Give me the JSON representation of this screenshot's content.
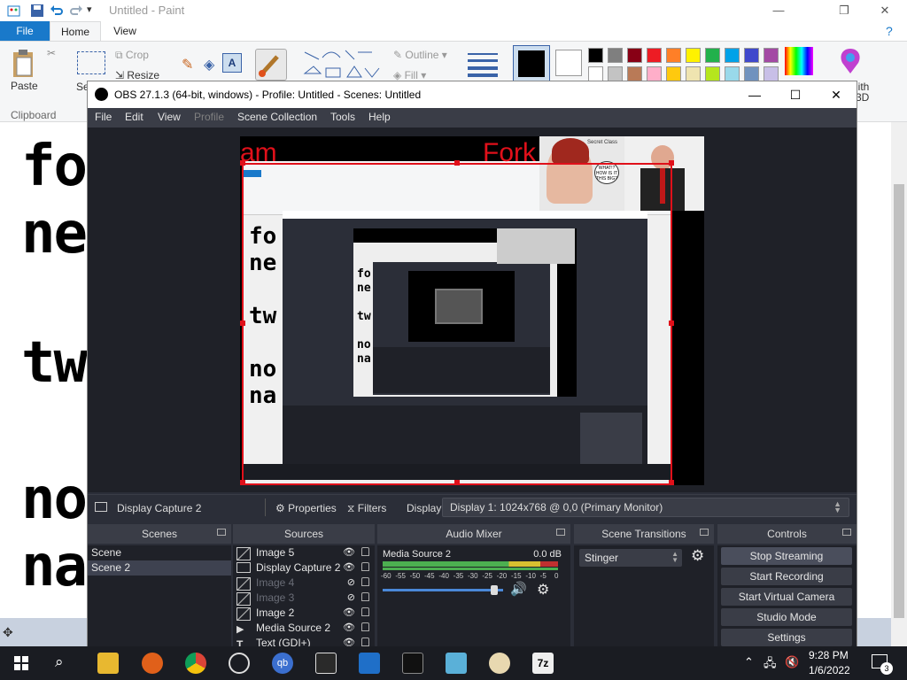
{
  "paint": {
    "title": "Untitled - Paint",
    "tabs": {
      "file": "File",
      "home": "Home",
      "view": "View"
    },
    "ribbon": {
      "paste": "Paste",
      "crop": "Crop",
      "resize": "Resize",
      "select_partial": "Se",
      "outline": "Outline",
      "fill": "Fill",
      "clipboard": "Clipboard",
      "edit_partial": "lith",
      "edit_partial2": "3D"
    },
    "canvas_text": [
      "fo",
      "ne",
      "tw",
      "no",
      "na"
    ],
    "palette": [
      "#000000",
      "#7f7f7f",
      "#880015",
      "#ed1c24",
      "#ff7f27",
      "#fff200",
      "#22b14c",
      "#00a2e8",
      "#3f48cc",
      "#a349a4"
    ],
    "palette_row2": [
      "#ffffff",
      "#c3c3c3",
      "#b97a57",
      "#ffaec9",
      "#ffc90e",
      "#efe4b0",
      "#b5e61d",
      "#99d9ea",
      "#7092be",
      "#c8bfe7"
    ]
  },
  "obs": {
    "title": "OBS 27.1.3 (64-bit, windows) - Profile: Untitled - Scenes: Untitled",
    "menu": [
      "File",
      "Edit",
      "View",
      "Profile",
      "Scene Collection",
      "Tools",
      "Help"
    ],
    "preview": {
      "red_words": [
        "am",
        "Fork"
      ],
      "comic_text": "WHAT!? HOW IS IT THIS BIG?",
      "comic_title": "Secret Class"
    },
    "source_bar": {
      "source_name": "Display Capture 2",
      "properties": "Properties",
      "filters": "Filters",
      "display_label": "Display",
      "display_value": "Display 1: 1024x768 @ 0,0 (Primary Monitor)"
    },
    "docks": {
      "scenes": {
        "title": "Scenes",
        "items": [
          {
            "label": "Scene",
            "selected": false
          },
          {
            "label": "Scene 2",
            "selected": true
          }
        ]
      },
      "sources": {
        "title": "Sources",
        "items": [
          {
            "label": "Image 5",
            "visible": true,
            "icon": "image-icon"
          },
          {
            "label": "Display Capture 2",
            "visible": true,
            "icon": "monitor-icon"
          },
          {
            "label": "Image 4",
            "visible": false,
            "icon": "image-icon"
          },
          {
            "label": "Image 3",
            "visible": false,
            "icon": "image-icon"
          },
          {
            "label": "Image 2",
            "visible": true,
            "icon": "image-icon"
          },
          {
            "label": "Media Source 2",
            "visible": true,
            "icon": "play-icon"
          },
          {
            "label": "Text (GDI+)",
            "visible": true,
            "icon": "text-icon"
          }
        ]
      },
      "audio": {
        "title": "Audio Mixer",
        "channel": "Media Source 2",
        "level": "0.0 dB",
        "scale": [
          "-60",
          "-55",
          "-50",
          "-45",
          "-40",
          "-35",
          "-30",
          "-25",
          "-20",
          "-15",
          "-10",
          "-5",
          "0"
        ],
        "volume_fraction": 0.95
      },
      "transitions": {
        "title": "Scene Transitions",
        "selected": "Stinger"
      },
      "controls": {
        "title": "Controls",
        "buttons": [
          "Stop Streaming",
          "Start Recording",
          "Start Virtual Camera",
          "Studio Mode",
          "Settings"
        ]
      }
    }
  },
  "taskbar": {
    "time": "9:28 PM",
    "date": "1/6/2022",
    "notification_count": "3"
  }
}
